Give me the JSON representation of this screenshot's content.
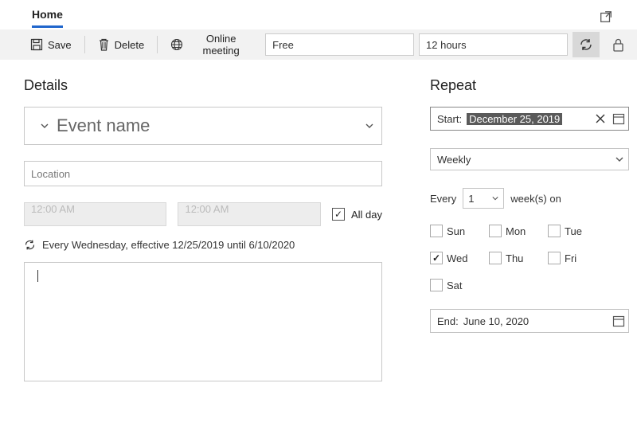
{
  "tabs": {
    "home": "Home"
  },
  "toolbar": {
    "save": "Save",
    "delete": "Delete",
    "online_meeting": "Online meeting",
    "show_as": "Free",
    "reminder": "12 hours"
  },
  "details": {
    "heading": "Details",
    "event_name_placeholder": "Event name",
    "location_placeholder": "Location",
    "start_time": "12:00 AM",
    "end_time": "12:00 AM",
    "all_day_label": "All day",
    "all_day_checked": true,
    "recurrence_text": "Every Wednesday, effective 12/25/2019 until 6/10/2020"
  },
  "repeat": {
    "heading": "Repeat",
    "start_label": "Start:",
    "start_date": "December 25, 2019",
    "frequency": "Weekly",
    "every_label": "Every",
    "interval": "1",
    "unit_label": "week(s) on",
    "days": [
      {
        "label": "Sun",
        "checked": false
      },
      {
        "label": "Mon",
        "checked": false
      },
      {
        "label": "Tue",
        "checked": false
      },
      {
        "label": "Wed",
        "checked": true
      },
      {
        "label": "Thu",
        "checked": false
      },
      {
        "label": "Fri",
        "checked": false
      },
      {
        "label": "Sat",
        "checked": false
      }
    ],
    "end_label": "End:",
    "end_date": "June 10, 2020"
  }
}
